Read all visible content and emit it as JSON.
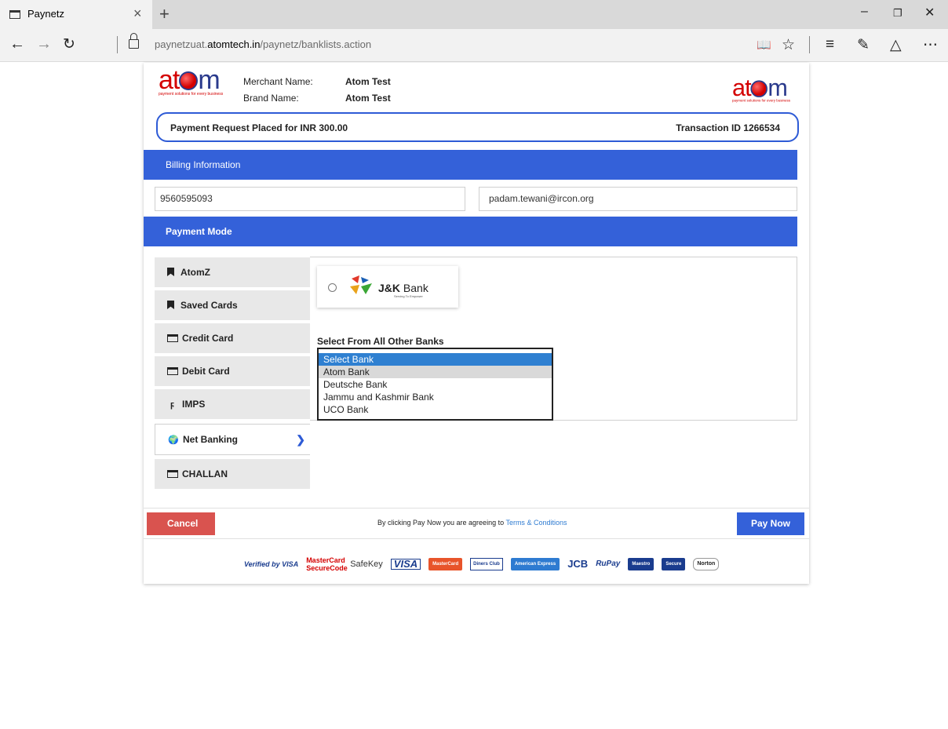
{
  "browser": {
    "tab_title": "Paynetz",
    "tab_close": "×",
    "new_tab": "+",
    "url_prefix": "paynetzuat.",
    "url_domain": "atomtech.in",
    "url_path": "/paynetz/banklists.action",
    "icons": [
      "back-icon",
      "forward-icon",
      "refresh-icon",
      "lock-icon",
      "reading-view-icon",
      "favorite-star-icon",
      "hub-icon",
      "web-note-icon",
      "share-icon",
      "more-icon"
    ]
  },
  "header": {
    "logo_text": "atom",
    "logo_tagline": "payment solutions for every business",
    "merchant_label": "Merchant Name:",
    "merchant_value": "Atom Test",
    "brand_label": "Brand Name:",
    "brand_value": "Atom Test"
  },
  "request": {
    "amount_text": "Payment Request Placed for INR  300.00",
    "transaction_text": "Transaction ID  1266534"
  },
  "billing": {
    "title": "Billing Information",
    "phone": "9560595093",
    "email": "padam.tewani@ircon.org"
  },
  "payment_mode": {
    "title": "Payment Mode",
    "items": [
      {
        "label": "AtomZ",
        "icon": "bookmark-icon"
      },
      {
        "label": "Saved Cards",
        "icon": "bookmark-icon"
      },
      {
        "label": "Credit Card",
        "icon": "credit-card-icon"
      },
      {
        "label": "Debit Card",
        "icon": "credit-card-icon"
      },
      {
        "label": "IMPS",
        "icon": "bolt-icon"
      },
      {
        "label": "Net Banking",
        "icon": "globe-icon",
        "active": true
      },
      {
        "label": "CHALLAN",
        "icon": "credit-card-icon"
      }
    ]
  },
  "net_banking": {
    "featured_bank_name": "J&K",
    "featured_bank_name2": "Bank",
    "featured_bank_tag": "Serving To Empower",
    "select_label": "Select From All Other Banks",
    "options": [
      "Select Bank",
      "Atom Bank",
      "Deutsche Bank",
      "Jammu and Kashmir Bank",
      "UCO Bank"
    ],
    "selected": "Select Bank"
  },
  "footer": {
    "cancel_label": "Cancel",
    "terms_prefix": "By clicking Pay Now you are agreeing to",
    "terms_link": "Terms & Conditions",
    "pay_label": "Pay Now"
  },
  "trust_logos": [
    "Verified by VISA",
    "MasterCard SecureCode",
    "SafeKey",
    "VISA",
    "MasterCard",
    "Diners Club",
    "American Express",
    "JCB",
    "RuPay",
    "Maestro",
    "Secure",
    "Norton"
  ],
  "colors": {
    "primary": "#3461d9",
    "cancel": "#d9534f",
    "brand_red": "#d40000",
    "brand_blue": "#2a3a8c",
    "selected_option": "#2f80d1"
  }
}
